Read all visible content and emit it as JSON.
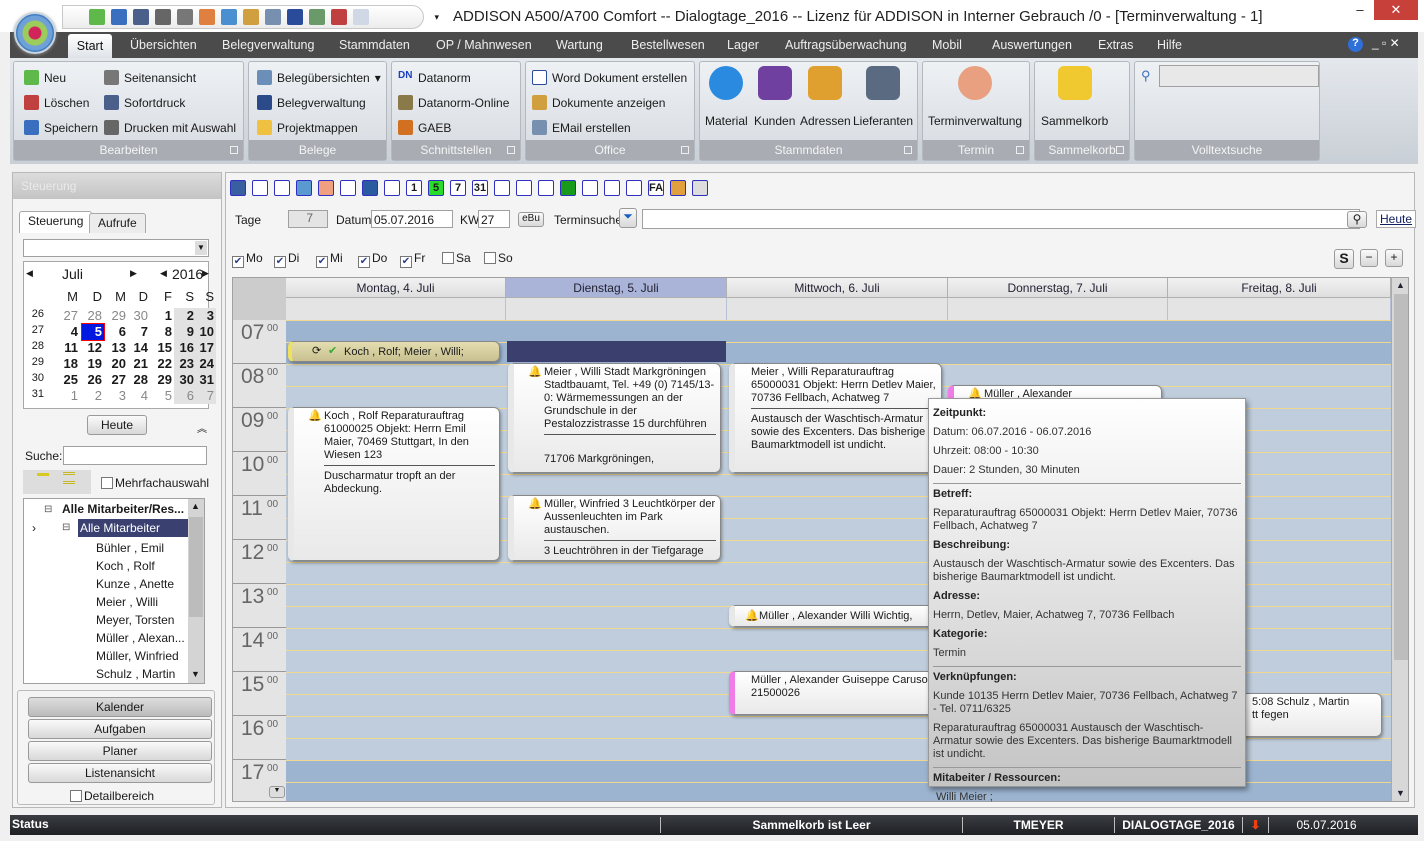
{
  "window": {
    "title": "ADDISON A500/A700 Comfort -- Dialogtage_2016 -- Lizenz für ADDISON in  Interner Gebrauch /0 - [Terminverwaltung - 1]",
    "minimize": "–",
    "maximize": "☐",
    "close": "✕"
  },
  "menu": [
    "Start",
    "Übersichten",
    "Belegverwaltung",
    "Stammdaten",
    "OP / Mahnwesen",
    "Wartung",
    "Bestellwesen",
    "Lager",
    "Auftragsüberwachung",
    "Mobil",
    "Auswertungen",
    "Extras",
    "Hilfe"
  ],
  "ribbon": {
    "bearbeiten": {
      "label": "Bearbeiten",
      "items": [
        "Neu",
        "Löschen",
        "Speichern",
        "Seitenansicht",
        "Sofortdruck",
        "Drucken mit Auswahl"
      ]
    },
    "belege": {
      "label": "Belege",
      "items": [
        "Belegübersichten",
        "Belegverwaltung",
        "Projektmappen"
      ]
    },
    "schnittstellen": {
      "label": "Schnittstellen",
      "items": [
        "Datanorm",
        "Datanorm-Online",
        "GAEB"
      ]
    },
    "office": {
      "label": "Office",
      "items": [
        "Word Dokument erstellen",
        "Dokumente anzeigen",
        "EMail erstellen"
      ]
    },
    "stammdaten": {
      "label": "Stammdaten",
      "items": [
        "Material",
        "Kunden",
        "Adressen",
        "Lieferanten"
      ]
    },
    "termin": {
      "label": "Termin",
      "items": [
        "Terminverwaltung"
      ]
    },
    "sammelkorb": {
      "label": "Sammelkorb",
      "items": [
        "Sammelkorb"
      ]
    },
    "volltextsuche": {
      "label": "Volltextsuche",
      "value": ""
    }
  },
  "left": {
    "header": "Steuerung",
    "tabs": [
      "Steuerung",
      "Aufrufe"
    ],
    "calendar": {
      "month": "Juli",
      "year": "2016",
      "weekdays": [
        "M",
        "D",
        "M",
        "D",
        "F",
        "S",
        "S"
      ],
      "weeks": [
        {
          "kw": "26",
          "days": [
            "27",
            "28",
            "29",
            "30",
            "1",
            "2",
            "3"
          ]
        },
        {
          "kw": "27",
          "days": [
            "4",
            "5",
            "6",
            "7",
            "8",
            "9",
            "10"
          ]
        },
        {
          "kw": "28",
          "days": [
            "11",
            "12",
            "13",
            "14",
            "15",
            "16",
            "17"
          ]
        },
        {
          "kw": "29",
          "days": [
            "18",
            "19",
            "20",
            "21",
            "22",
            "23",
            "24"
          ]
        },
        {
          "kw": "30",
          "days": [
            "25",
            "26",
            "27",
            "28",
            "29",
            "30",
            "31"
          ]
        },
        {
          "kw": "31",
          "days": [
            "1",
            "2",
            "3",
            "4",
            "5",
            "6",
            "7"
          ]
        }
      ],
      "selected": "5",
      "today_button": "Heute"
    },
    "search_label": "Suche:",
    "search_value": "",
    "multi_select": "Mehrfachauswahl",
    "tree": {
      "root": "Alle Mitarbeiter/Res...",
      "group": "Alle Mitarbeiter",
      "items": [
        "Bühler    , Emil",
        "Koch , Rolf",
        "Kunze , Anette",
        "Meier , Willi",
        "Meyer, Torsten",
        "Müller    , Alexan...",
        "Müller, Winfried",
        "Schulz  , Martin"
      ]
    },
    "nav": [
      "Kalender",
      "Aufgaben",
      "Planer",
      "Listenansicht"
    ],
    "detail": "Detailbereich"
  },
  "controls": {
    "tage_label": "Tage",
    "tage": "7",
    "datum_label": "Datum",
    "datum": "05.07.2016",
    "kw_label": "KW",
    "kw": "27",
    "ebu": "eBu",
    "terminsuche_label": "Terminsuche",
    "terminsuche": "",
    "heute": "Heute",
    "days": [
      {
        "label": "Mo",
        "checked": true
      },
      {
        "label": "Di",
        "checked": true
      },
      {
        "label": "Mi",
        "checked": true
      },
      {
        "label": "Do",
        "checked": true
      },
      {
        "label": "Fr",
        "checked": true
      },
      {
        "label": "Sa",
        "checked": false
      },
      {
        "label": "So",
        "checked": false
      }
    ]
  },
  "calendar": {
    "days": [
      "Montag, 4. Juli",
      "Dienstag, 5. Juli",
      "Mittwoch, 6. Juli",
      "Donnerstag, 7. Juli",
      "Freitag, 8. Juli"
    ],
    "selected_day": "Dienstag, 5. Juli",
    "hours": [
      "07",
      "08",
      "09",
      "10",
      "11",
      "12",
      "13",
      "14",
      "15",
      "16",
      "17"
    ],
    "minutes": "00",
    "events": [
      {
        "title": "Koch , Rolf; Meier , Willi;"
      },
      {
        "title": "Koch , Rolf Reparaturauftrag 61000025 Objekt:  Herrn Emil Maier, 70469 Stuttgart, In den Wiesen 123",
        "body": "Duscharmatur tropft an der Abdeckung."
      },
      {
        "title": "Meier , Willi Stadt Markgröningen Stadtbauamt, Tel. +49 (0) 7145/13-0: Wärmemessungen an der Grundschule in der Pestalozzistrasse 15 durchführen",
        "body": "71706 Markgröningen,"
      },
      {
        "title": "Müller, Winfried 3 Leuchtkörper der Aussenleuchten im Park austauschen.",
        "body": "3 Leuchtröhren in der Tiefgarage"
      },
      {
        "title": "Meier , Willi Reparaturauftrag 65000031 Objekt:  Herrn Detlev Maier, 70736 Fellbach, Achatweg 7",
        "body": "Austausch der Waschtisch-Armatur sowie des Excenters. Das bisherige Baumarktmodell ist undicht."
      },
      {
        "title": "Müller    , Alexander"
      },
      {
        "title": "Müller    , Alexander  Willi Wichtig,"
      },
      {
        "title": "Müller    , Alexander  Guiseppe Caruso,  21500026"
      },
      {
        "title": "5:08 Schulz  , Martin",
        "body": "tt fegen"
      }
    ]
  },
  "tooltip": {
    "zeitpunkt": "Zeitpunkt:",
    "datum": "Datum: 06.07.2016 - 06.07.2016",
    "uhrzeit": "Uhrzeit: 08:00 - 10:30",
    "dauer": "Dauer: 2 Stunden, 30 Minuten",
    "betreff_h": "Betreff:",
    "betreff": "Reparaturauftrag 65000031 Objekt:  Herrn Detlev Maier, 70736 Fellbach, Achatweg 7",
    "beschreibung_h": "Beschreibung:",
    "beschreibung": "Austausch der Waschtisch-Armatur sowie des Excenters. Das bisherige Baumarktmodell ist undicht.",
    "adresse_h": "Adresse:",
    "adresse": "Herrn, Detlev, Maier, Achatweg 7, 70736 Fellbach",
    "kategorie_h": "Kategorie:",
    "kategorie": "Termin",
    "verkn_h": "Verknüpfungen:",
    "verkn1": "Kunde 10135 Herrn Detlev Maier, 70736 Fellbach, Achatweg 7 - Tel. 0711/6325",
    "verkn2": "Reparaturauftrag 65000031 Austausch der Waschtisch-Armatur sowie des Excenters. Das bisherige Baumarktmodell ist undicht.",
    "mitarbeiter_h": "Mitabeiter / Ressourcen:",
    "mitarbeiter": "Willi Meier ;"
  },
  "status": {
    "label": "Status",
    "sammelkorb": "Sammelkorb ist   Leer",
    "user": "TMEYER",
    "db": "DIALOGTAGE_2016",
    "date": "05.07.2016"
  },
  "colors": {
    "accent": "#0018e0",
    "selected_day": "#aab3d8",
    "selected_slot": "#3a3f6e",
    "allday_event": "#d8d2a0",
    "category_pink": "#f07ce8",
    "grid_work": "#bfcddc",
    "grid_offhours": "#9cb4d0"
  }
}
